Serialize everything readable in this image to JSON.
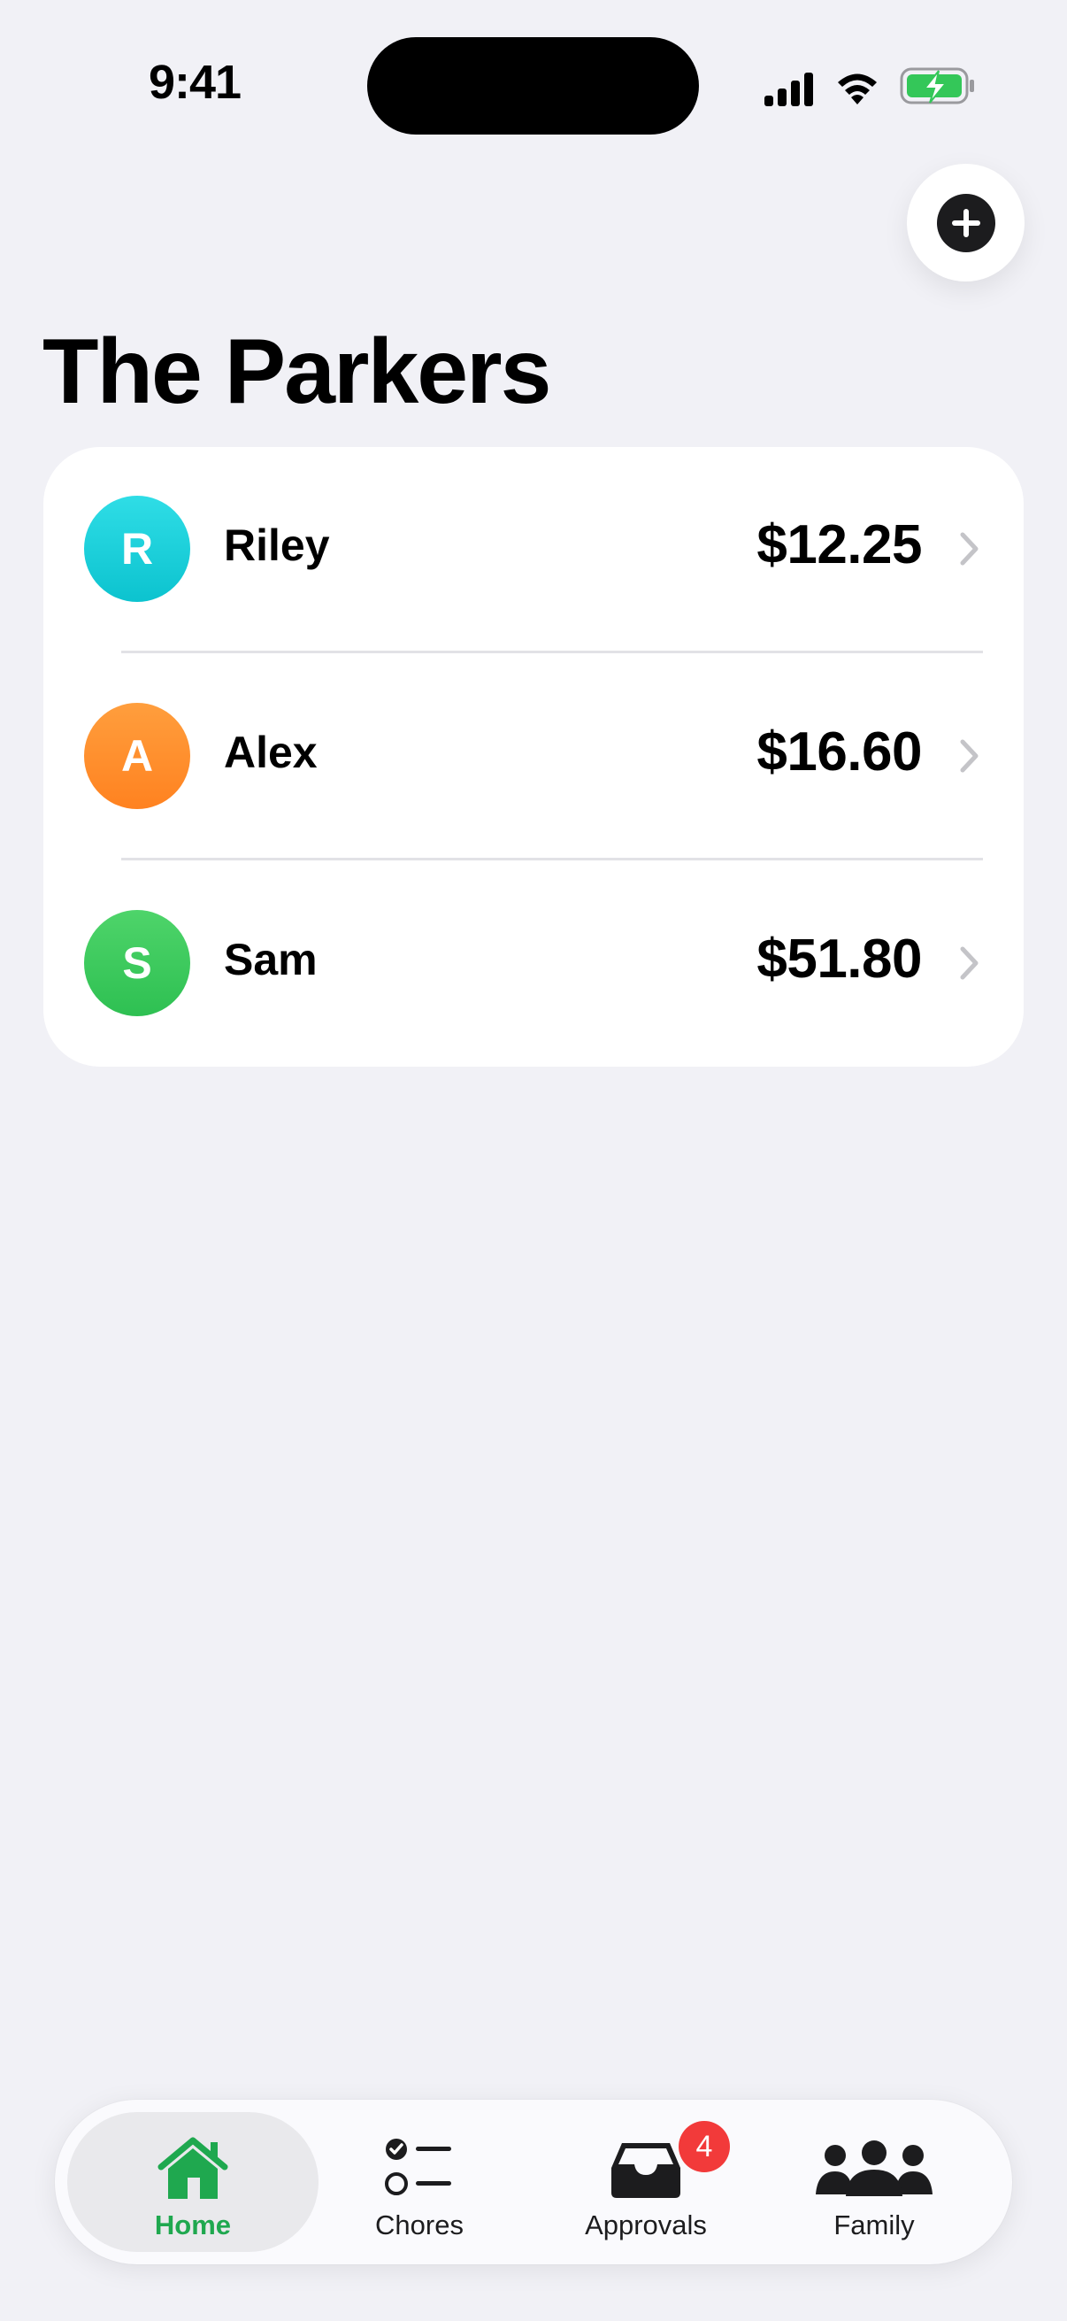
{
  "status_bar": {
    "time": "9:41"
  },
  "header": {
    "title": "The Parkers"
  },
  "members": [
    {
      "initial": "R",
      "name": "Riley",
      "balance": "$12.25",
      "color": "#14C8D4"
    },
    {
      "initial": "A",
      "name": "Alex",
      "balance": "$16.60",
      "color": "#FF8A2A"
    },
    {
      "initial": "S",
      "name": "Sam",
      "balance": "$51.80",
      "color": "#34C759"
    }
  ],
  "tab_bar": {
    "tabs": [
      {
        "label": "Home",
        "icon": "house-icon",
        "active": true
      },
      {
        "label": "Chores",
        "icon": "checklist-icon",
        "active": false
      },
      {
        "label": "Approvals",
        "icon": "inbox-tray-icon",
        "active": false,
        "badge": "4"
      },
      {
        "label": "Family",
        "icon": "people-icon",
        "active": false
      }
    ]
  },
  "colors": {
    "accent": "#1FA84F",
    "badge": "#F23A3A",
    "background": "#F1F1F6"
  }
}
